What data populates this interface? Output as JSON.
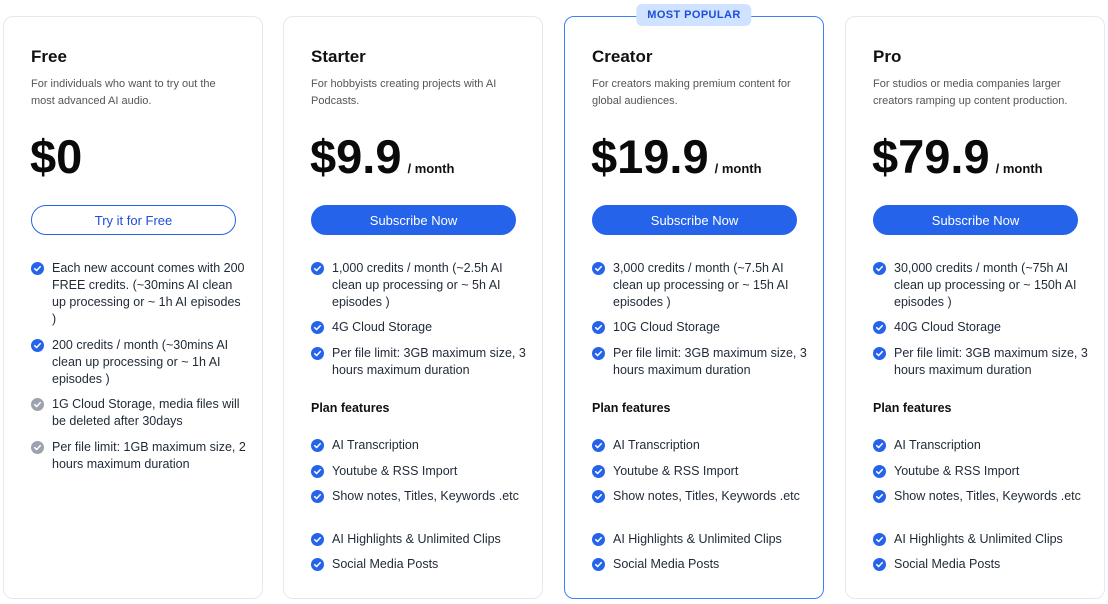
{
  "accent_color": "#2563eb",
  "muted_check_color": "#9ca3af",
  "plans": [
    {
      "name": "Free",
      "description": "For individuals who want to try out the most advanced AI audio.",
      "price": "$0",
      "period": "",
      "button_label": "Try it for Free",
      "features": [
        "Each new account comes with 200 FREE credits. (~30mins AI clean up processing or ~ 1h AI episodes )",
        "200 credits / month (~30mins AI clean up processing or ~ 1h AI episodes )",
        "1G Cloud Storage, media files will be deleted after 30days",
        "Per file limit: 1GB maximum size, 2 hours maximum duration"
      ]
    },
    {
      "name": "Starter",
      "description": "For hobbyists creating projects with AI Podcasts.",
      "price": "$9.9",
      "period": "/ month",
      "button_label": "Subscribe Now",
      "features": [
        "1,000 credits / month (~2.5h AI clean up processing or ~ 5h AI episodes )",
        "4G Cloud Storage",
        "Per file limit: 3GB maximum size, 3 hours maximum duration"
      ],
      "plan_features_title": "Plan features",
      "plan_features": [
        "AI Transcription",
        "Youtube & RSS Import",
        "Show notes, Titles, Keywords .etc",
        "AI Highlights & Unlimited Clips",
        "Social Media Posts"
      ]
    },
    {
      "name": "Creator",
      "badge": "MOST POPULAR",
      "description": "For creators making premium content for global audiences.",
      "price": "$19.9",
      "period": "/ month",
      "button_label": "Subscribe Now",
      "features": [
        "3,000 credits / month (~7.5h AI clean up processing or ~ 15h AI episodes )",
        "10G Cloud Storage",
        "Per file limit: 3GB maximum size, 3 hours maximum duration"
      ],
      "plan_features_title": "Plan features",
      "plan_features": [
        "AI Transcription",
        "Youtube & RSS Import",
        "Show notes, Titles, Keywords .etc",
        "AI Highlights & Unlimited Clips",
        "Social Media Posts"
      ]
    },
    {
      "name": "Pro",
      "description": "For studios or media companies larger creators ramping up content production.",
      "price": "$79.9",
      "period": "/ month",
      "button_label": "Subscribe Now",
      "features": [
        "30,000 credits / month (~75h AI clean up processing or ~ 150h AI episodes )",
        "40G Cloud Storage",
        "Per file limit: 3GB maximum size, 3 hours maximum duration"
      ],
      "plan_features_title": "Plan features",
      "plan_features": [
        "AI Transcription",
        "Youtube & RSS Import",
        "Show notes, Titles, Keywords .etc",
        "AI Highlights & Unlimited Clips",
        "Social Media Posts"
      ]
    }
  ]
}
